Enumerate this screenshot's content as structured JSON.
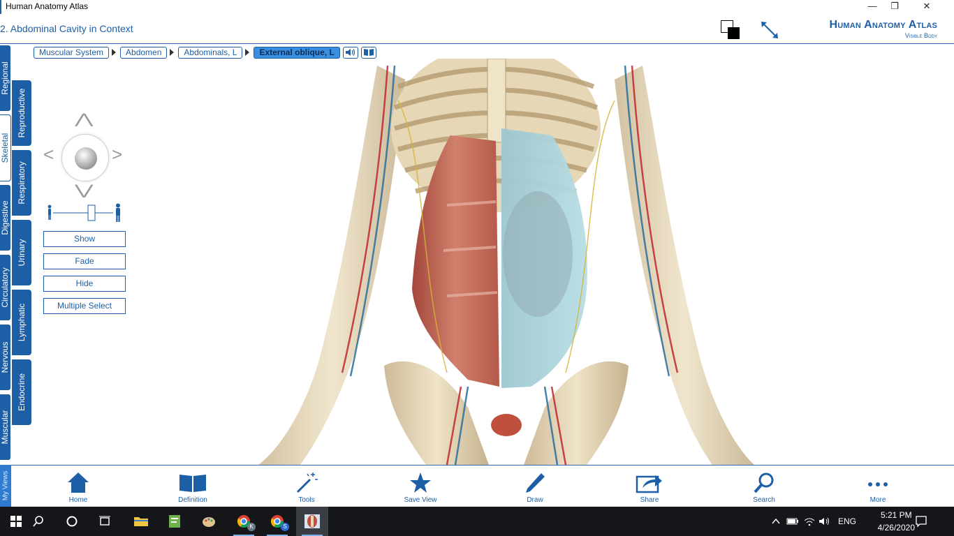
{
  "window": {
    "title": "Human Anatomy Atlas",
    "minimize_glyph": "—",
    "maximize_glyph": "❐",
    "close_glyph": "✕"
  },
  "header": {
    "scene_title": "2. Abdominal Cavity in Context",
    "brand_line1": "Human Anatomy Atlas",
    "brand_line2": "Visible Body",
    "accent": "#1d5fa6"
  },
  "breadcrumb": {
    "items": [
      "Muscular System",
      "Abdomen",
      "Abdominals, L",
      "External oblique, L"
    ],
    "active_index": 3
  },
  "system_tabs": {
    "column_a": [
      "Regional",
      "Skeletal",
      "Digestive",
      "Circulatory",
      "Nervous",
      "Muscular"
    ],
    "column_b": [
      "Reproductive",
      "Respiratory",
      "Urinary",
      "Lymphatic",
      "Endocrine"
    ],
    "active": "Skeletal",
    "my_views": "My Views"
  },
  "controls": {
    "show": "Show",
    "fade": "Fade",
    "hide": "Hide",
    "multiple_select": "Multiple Select",
    "nav_up": "⋀",
    "nav_down": "⋁",
    "nav_left": "<",
    "nav_right": ">",
    "zoom_level": 0.5
  },
  "toolbar": {
    "items": [
      "Home",
      "Definition",
      "Tools",
      "Save View",
      "Draw",
      "Share",
      "Search",
      "More"
    ]
  },
  "taskbar": {
    "lang": "ENG",
    "time": "5:21 PM",
    "date": "4/26/2020",
    "chrome_badge_1": "K",
    "chrome_badge_2": "S",
    "colors": {
      "bg": "#15161a",
      "active": "#3b3d44"
    }
  }
}
